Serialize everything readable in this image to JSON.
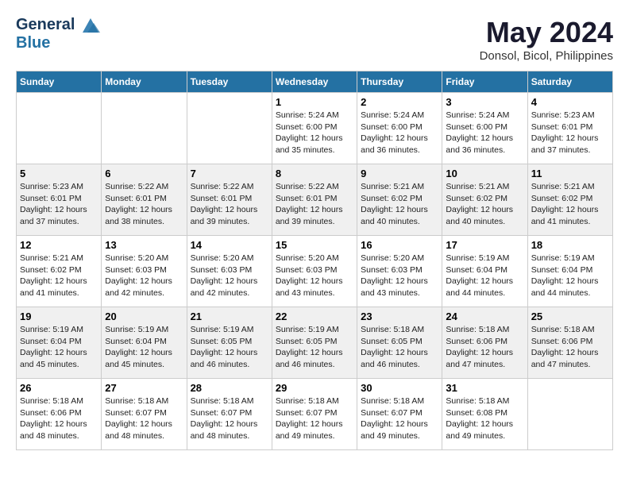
{
  "header": {
    "logo_line1": "General",
    "logo_line2": "Blue",
    "month_title": "May 2024",
    "location": "Donsol, Bicol, Philippines"
  },
  "days_of_week": [
    "Sunday",
    "Monday",
    "Tuesday",
    "Wednesday",
    "Thursday",
    "Friday",
    "Saturday"
  ],
  "weeks": [
    [
      {
        "day": "",
        "content": ""
      },
      {
        "day": "",
        "content": ""
      },
      {
        "day": "",
        "content": ""
      },
      {
        "day": "1",
        "content": "Sunrise: 5:24 AM\nSunset: 6:00 PM\nDaylight: 12 hours\nand 35 minutes."
      },
      {
        "day": "2",
        "content": "Sunrise: 5:24 AM\nSunset: 6:00 PM\nDaylight: 12 hours\nand 36 minutes."
      },
      {
        "day": "3",
        "content": "Sunrise: 5:24 AM\nSunset: 6:00 PM\nDaylight: 12 hours\nand 36 minutes."
      },
      {
        "day": "4",
        "content": "Sunrise: 5:23 AM\nSunset: 6:01 PM\nDaylight: 12 hours\nand 37 minutes."
      }
    ],
    [
      {
        "day": "5",
        "content": "Sunrise: 5:23 AM\nSunset: 6:01 PM\nDaylight: 12 hours\nand 37 minutes."
      },
      {
        "day": "6",
        "content": "Sunrise: 5:22 AM\nSunset: 6:01 PM\nDaylight: 12 hours\nand 38 minutes."
      },
      {
        "day": "7",
        "content": "Sunrise: 5:22 AM\nSunset: 6:01 PM\nDaylight: 12 hours\nand 39 minutes."
      },
      {
        "day": "8",
        "content": "Sunrise: 5:22 AM\nSunset: 6:01 PM\nDaylight: 12 hours\nand 39 minutes."
      },
      {
        "day": "9",
        "content": "Sunrise: 5:21 AM\nSunset: 6:02 PM\nDaylight: 12 hours\nand 40 minutes."
      },
      {
        "day": "10",
        "content": "Sunrise: 5:21 AM\nSunset: 6:02 PM\nDaylight: 12 hours\nand 40 minutes."
      },
      {
        "day": "11",
        "content": "Sunrise: 5:21 AM\nSunset: 6:02 PM\nDaylight: 12 hours\nand 41 minutes."
      }
    ],
    [
      {
        "day": "12",
        "content": "Sunrise: 5:21 AM\nSunset: 6:02 PM\nDaylight: 12 hours\nand 41 minutes."
      },
      {
        "day": "13",
        "content": "Sunrise: 5:20 AM\nSunset: 6:03 PM\nDaylight: 12 hours\nand 42 minutes."
      },
      {
        "day": "14",
        "content": "Sunrise: 5:20 AM\nSunset: 6:03 PM\nDaylight: 12 hours\nand 42 minutes."
      },
      {
        "day": "15",
        "content": "Sunrise: 5:20 AM\nSunset: 6:03 PM\nDaylight: 12 hours\nand 43 minutes."
      },
      {
        "day": "16",
        "content": "Sunrise: 5:20 AM\nSunset: 6:03 PM\nDaylight: 12 hours\nand 43 minutes."
      },
      {
        "day": "17",
        "content": "Sunrise: 5:19 AM\nSunset: 6:04 PM\nDaylight: 12 hours\nand 44 minutes."
      },
      {
        "day": "18",
        "content": "Sunrise: 5:19 AM\nSunset: 6:04 PM\nDaylight: 12 hours\nand 44 minutes."
      }
    ],
    [
      {
        "day": "19",
        "content": "Sunrise: 5:19 AM\nSunset: 6:04 PM\nDaylight: 12 hours\nand 45 minutes."
      },
      {
        "day": "20",
        "content": "Sunrise: 5:19 AM\nSunset: 6:04 PM\nDaylight: 12 hours\nand 45 minutes."
      },
      {
        "day": "21",
        "content": "Sunrise: 5:19 AM\nSunset: 6:05 PM\nDaylight: 12 hours\nand 46 minutes."
      },
      {
        "day": "22",
        "content": "Sunrise: 5:19 AM\nSunset: 6:05 PM\nDaylight: 12 hours\nand 46 minutes."
      },
      {
        "day": "23",
        "content": "Sunrise: 5:18 AM\nSunset: 6:05 PM\nDaylight: 12 hours\nand 46 minutes."
      },
      {
        "day": "24",
        "content": "Sunrise: 5:18 AM\nSunset: 6:06 PM\nDaylight: 12 hours\nand 47 minutes."
      },
      {
        "day": "25",
        "content": "Sunrise: 5:18 AM\nSunset: 6:06 PM\nDaylight: 12 hours\nand 47 minutes."
      }
    ],
    [
      {
        "day": "26",
        "content": "Sunrise: 5:18 AM\nSunset: 6:06 PM\nDaylight: 12 hours\nand 48 minutes."
      },
      {
        "day": "27",
        "content": "Sunrise: 5:18 AM\nSunset: 6:07 PM\nDaylight: 12 hours\nand 48 minutes."
      },
      {
        "day": "28",
        "content": "Sunrise: 5:18 AM\nSunset: 6:07 PM\nDaylight: 12 hours\nand 48 minutes."
      },
      {
        "day": "29",
        "content": "Sunrise: 5:18 AM\nSunset: 6:07 PM\nDaylight: 12 hours\nand 49 minutes."
      },
      {
        "day": "30",
        "content": "Sunrise: 5:18 AM\nSunset: 6:07 PM\nDaylight: 12 hours\nand 49 minutes."
      },
      {
        "day": "31",
        "content": "Sunrise: 5:18 AM\nSunset: 6:08 PM\nDaylight: 12 hours\nand 49 minutes."
      },
      {
        "day": "",
        "content": ""
      }
    ]
  ]
}
